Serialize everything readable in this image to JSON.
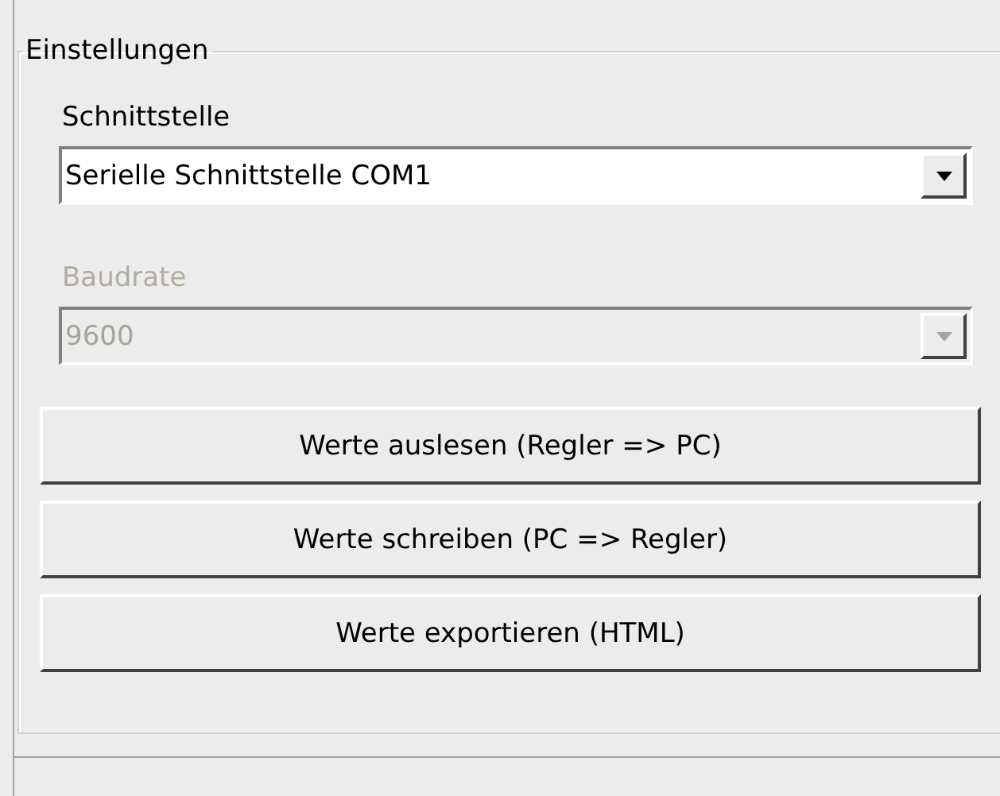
{
  "group": {
    "title": "Einstellungen"
  },
  "fields": [
    {
      "label": "Schnittstelle",
      "value": "Serielle Schnittstelle COM1",
      "disabled": false
    },
    {
      "label": "Baudrate",
      "value": "9600",
      "disabled": true
    }
  ],
  "buttons": [
    "Werte auslesen (Regler => PC)",
    "Werte schreiben (PC => Regler)",
    "Werte exportieren (HTML)"
  ]
}
